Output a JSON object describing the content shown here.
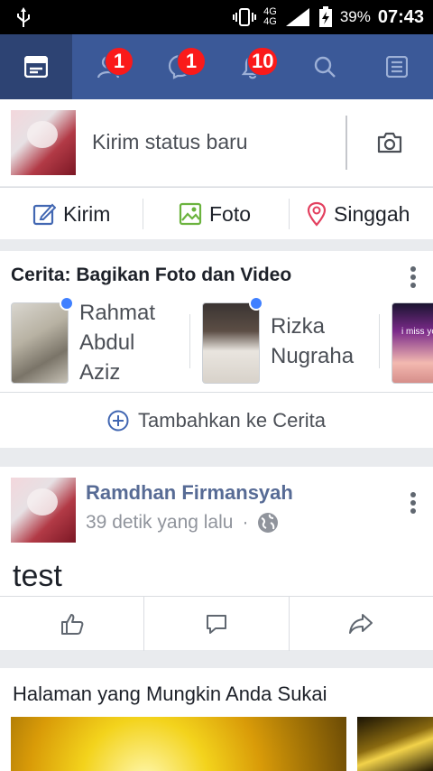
{
  "status_bar": {
    "network": "4G",
    "network_secondary": "4G",
    "battery_percent": "39%",
    "time": "07:43"
  },
  "nav": {
    "tabs": [
      {
        "name": "news-feed",
        "icon": "news-feed-icon",
        "badge": ""
      },
      {
        "name": "friend-requests",
        "icon": "friends-icon",
        "badge": "1"
      },
      {
        "name": "messages",
        "icon": "messenger-icon",
        "badge": "1"
      },
      {
        "name": "notifications",
        "icon": "bell-icon",
        "badge": "10"
      },
      {
        "name": "search",
        "icon": "search-icon",
        "badge": ""
      },
      {
        "name": "menu",
        "icon": "menu-list-icon",
        "badge": ""
      }
    ]
  },
  "composer": {
    "placeholder": "Kirim status baru",
    "camera_icon": "camera-icon"
  },
  "composer_actions": {
    "post_label": "Kirim",
    "photo_label": "Foto",
    "checkin_label": "Singgah"
  },
  "stories": {
    "title": "Cerita: Bagikan Foto dan Video",
    "items": [
      {
        "name_lines": [
          "Rahmat",
          "Abdul",
          "Aziz"
        ]
      },
      {
        "name_lines": [
          "Rizka",
          "Nugraha"
        ]
      },
      {
        "thumb_caption": "i miss yo"
      }
    ],
    "add_label": "Tambahkan ke Cerita"
  },
  "post": {
    "author": "Ramdhan Firmansyah",
    "time": "39 detik yang lalu",
    "separator": "·",
    "privacy_icon": "globe-icon",
    "text": "test",
    "actions": [
      "like-icon",
      "comment-icon",
      "share-icon"
    ]
  },
  "suggested_pages": {
    "title": "Halaman yang Mungkin Anda Sukai"
  },
  "colors": {
    "brand": "#3b5998",
    "badge": "#fa1a1a",
    "link": "#576b95",
    "story_dot": "#4080ff"
  }
}
